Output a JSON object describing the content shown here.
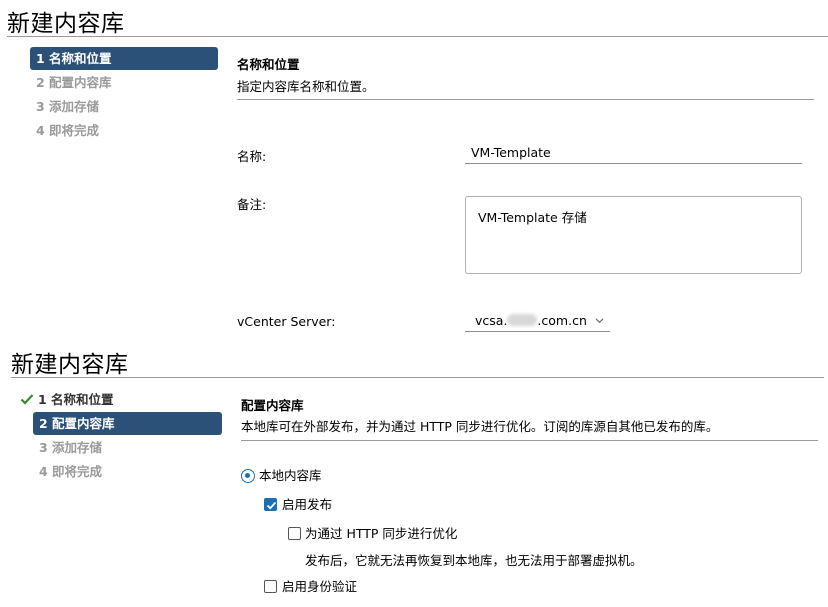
{
  "panel1": {
    "title": "新建内容库",
    "steps": [
      "1 名称和位置",
      "2 配置内容库",
      "3 添加存储",
      "4 即将完成"
    ],
    "section_title": "名称和位置",
    "section_desc": "指定内容库名称和位置。",
    "name_label": "名称:",
    "name_value": "VM-Template",
    "notes_label": "备注:",
    "notes_value": "VM-Template 存储",
    "vcenter_label": "vCenter Server:",
    "vcenter_prefix": "vcsa.",
    "vcenter_suffix": ".com.cn"
  },
  "panel2": {
    "title": "新建内容库",
    "steps": [
      "1 名称和位置",
      "2 配置内容库",
      "3 添加存储",
      "4 即将完成"
    ],
    "section_title": "配置内容库",
    "section_desc": "本地库可在外部发布，并为通过 HTTP 同步进行优化。订阅的库源自其他已发布的库。",
    "local_library": "本地内容库",
    "enable_publish": "启用发布",
    "optimize_http": "为通过 HTTP 同步进行优化",
    "optimize_note": "发布后，它就无法再恢复到本地库，也无法用于部署虚拟机。",
    "enable_auth": "启用身份验证"
  },
  "colors": {
    "accent": "#2b5178",
    "check": "#1a6fb5",
    "done_check": "#3c8a2e"
  },
  "icons": [
    "checkmark-icon",
    "chevron-down-icon",
    "radio-selected-icon",
    "checkbox-checked-icon",
    "checkbox-empty-icon"
  ]
}
